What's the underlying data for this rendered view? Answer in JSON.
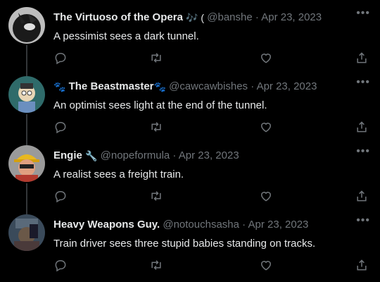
{
  "colors": {
    "background": "#000000",
    "text": "#e7e9ea",
    "muted": "#71767b",
    "thread_line": "#333639"
  },
  "icons": {
    "reply": "reply-icon",
    "retweet": "retweet-icon",
    "like": "like-icon",
    "share": "share-icon",
    "more": "more-icon"
  },
  "tweets": [
    {
      "name": "The Virtuoso of the Opera",
      "name_suffix": "🎶 (",
      "handle": "@banshe",
      "separator": " · ",
      "date": "Apr 23, 2023",
      "text": "A pessimist sees a dark tunnel."
    },
    {
      "name_prefix": "🐾",
      "name": "The Beastmaster",
      "name_suffix": "🐾",
      "handle": "@cawcawbishes",
      "separator": " · ",
      "date": "Apr 23, 2023",
      "text": "An optimist sees light at the end of the tunnel."
    },
    {
      "name": "Engie",
      "name_suffix": "🔧",
      "handle": "@nopeformula",
      "separator": " · ",
      "date": "Apr 23, 2023",
      "text": "A realist sees a freight train."
    },
    {
      "name": "Heavy Weapons Guy.",
      "handle": "@notouchsasha",
      "separator": " · ",
      "date": "Apr 23, 2023",
      "text": "Train driver sees three stupid babies standing on tracks."
    }
  ]
}
